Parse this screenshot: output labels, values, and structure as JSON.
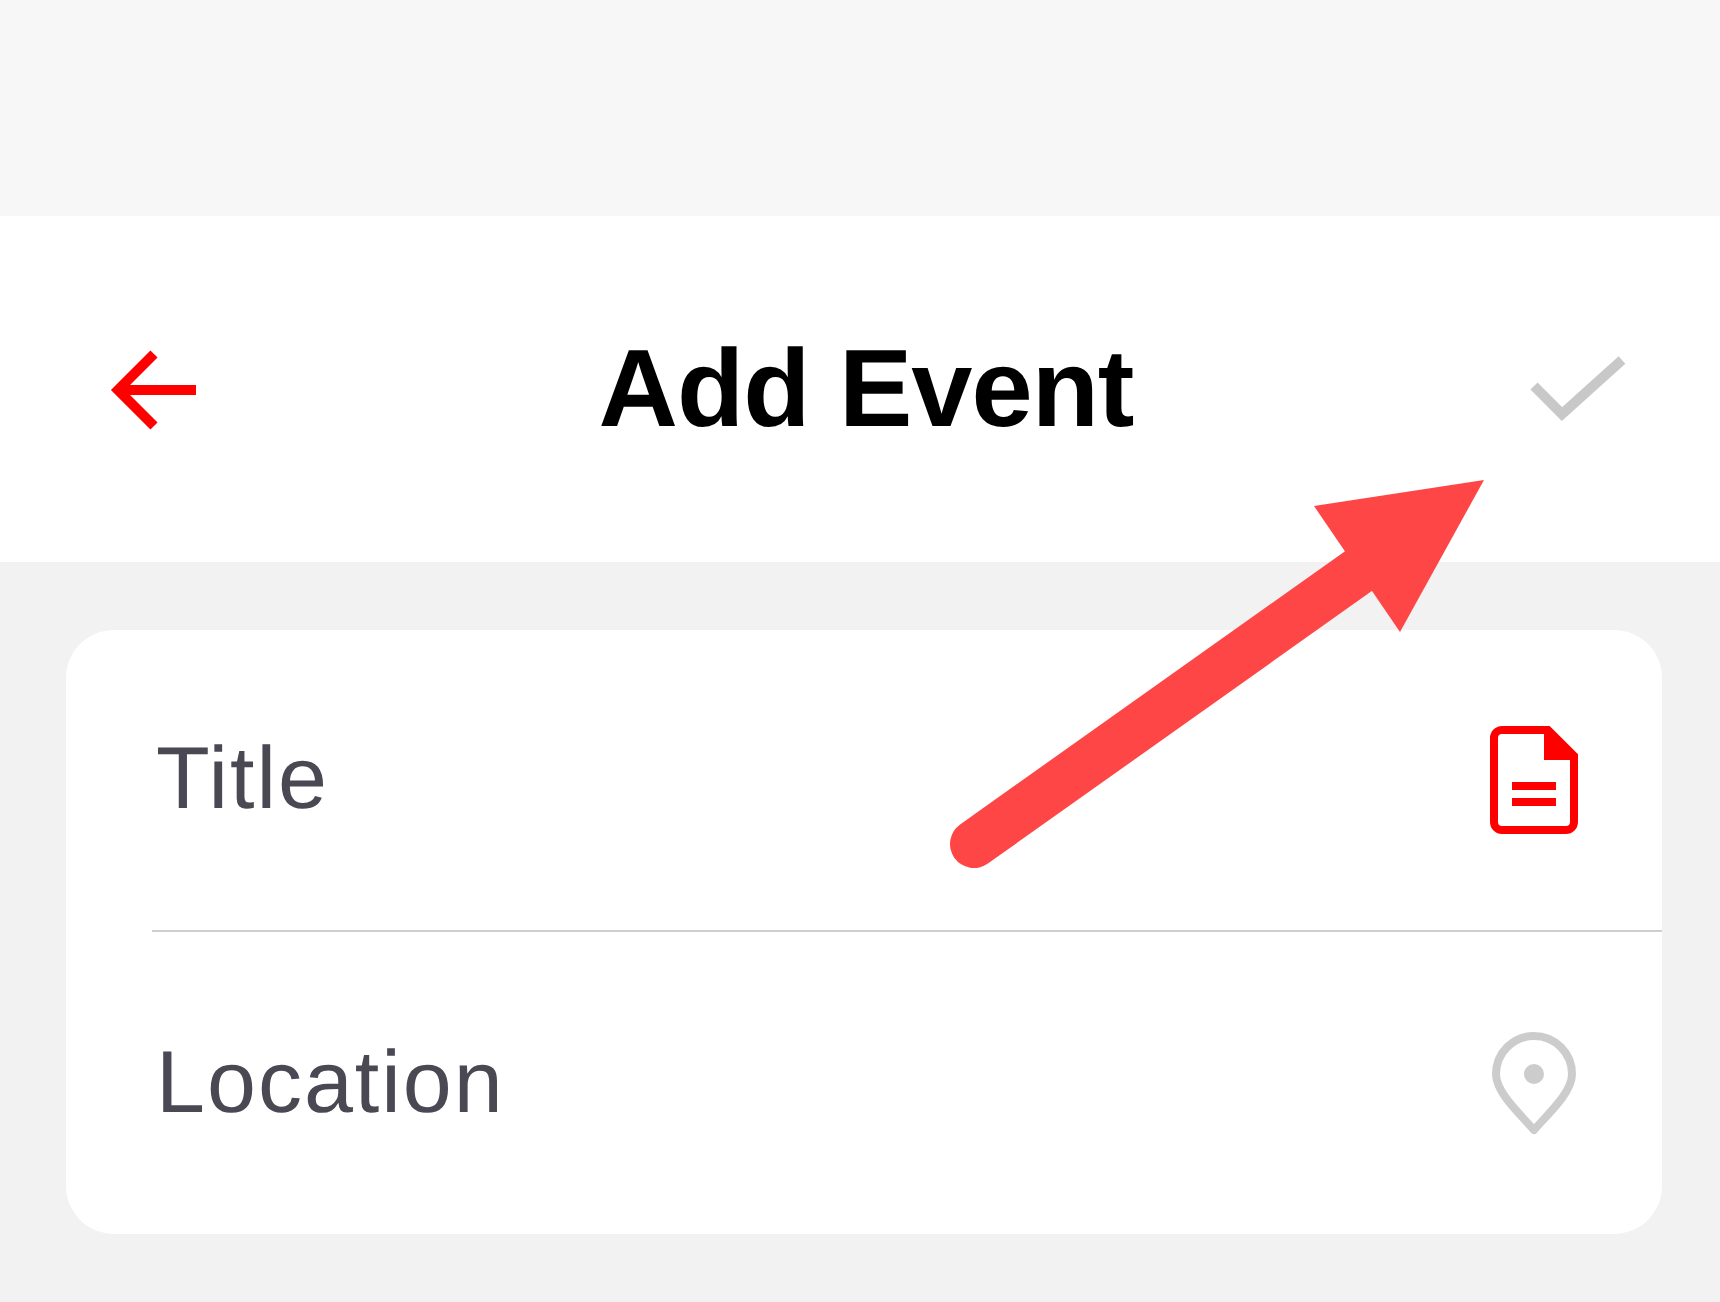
{
  "header": {
    "title": "Add Event",
    "confirm_enabled": false
  },
  "fields": [
    {
      "kind": "title",
      "placeholder": "Title",
      "active": true
    },
    {
      "kind": "location",
      "placeholder": "Location",
      "active": false
    }
  ]
}
